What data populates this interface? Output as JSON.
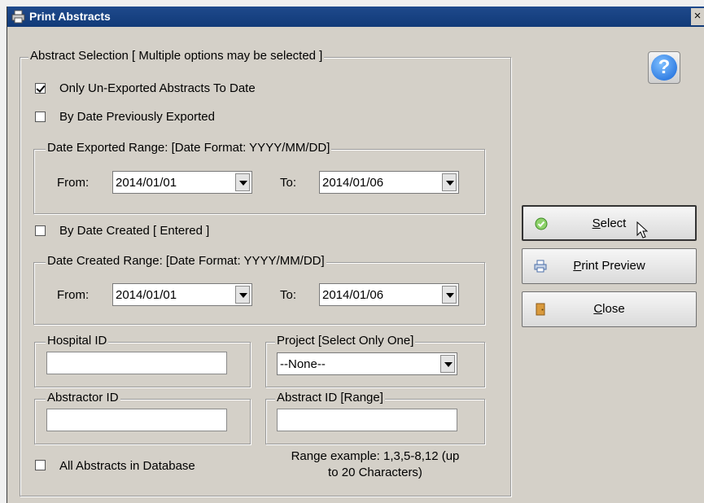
{
  "window": {
    "title": "Print Abstracts",
    "close_glyph": "×"
  },
  "abstract_selection": {
    "legend": "Abstract Selection [ Multiple options may be selected ]",
    "only_unexported": {
      "label": "Only Un-Exported Abstracts To Date",
      "checked": true
    },
    "by_date_exported": {
      "label": "By Date Previously Exported",
      "checked": false
    },
    "exported_range": {
      "legend": "Date Exported Range: [Date Format: YYYY/MM/DD]",
      "from_label": "From:",
      "from_value": "2014/01/01",
      "to_label": "To:",
      "to_value": "2014/01/06"
    },
    "by_date_created": {
      "label": "By Date Created [ Entered ]",
      "checked": false
    },
    "created_range": {
      "legend": "Date Created Range: [Date Format: YYYY/MM/DD]",
      "from_label": "From:",
      "from_value": "2014/01/01",
      "to_label": "To:",
      "to_value": "2014/01/06"
    },
    "hospital_id": {
      "legend": "Hospital ID",
      "value": ""
    },
    "project": {
      "legend": "Project [Select Only One]",
      "value": "--None--"
    },
    "abstractor_id": {
      "legend": "Abstractor ID",
      "value": ""
    },
    "abstract_id_range": {
      "legend": "Abstract ID [Range]",
      "value": ""
    },
    "all_abstracts": {
      "label": "All Abstracts in Database",
      "checked": false
    },
    "range_note_line1": "Range example: 1,3,5-8,12 (up",
    "range_note_line2": "to 20 Characters)"
  },
  "buttons": {
    "select": "Select",
    "print_preview": "Print Preview",
    "close": "Close"
  },
  "icons": {
    "app": "printer-icon",
    "help": "help-icon",
    "select": "check-circle-icon",
    "print_preview": "printer-icon",
    "close": "door-icon"
  },
  "colors": {
    "titlebar": "#113a78",
    "dialog_bg": "#d4d0c8"
  }
}
